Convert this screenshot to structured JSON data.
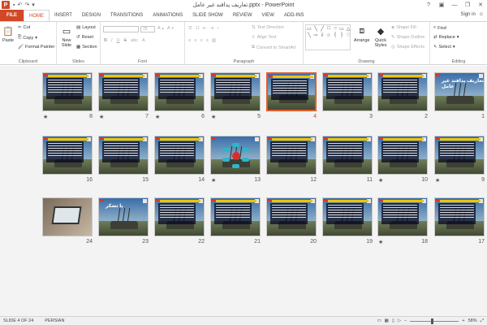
{
  "app": {
    "title": "تعاريف پدافند غير عامل.pptx - PowerPoint",
    "icon_letter": "P",
    "signin": "Sign in"
  },
  "tabs": [
    {
      "label": "FILE"
    },
    {
      "label": "HOME"
    },
    {
      "label": "INSERT"
    },
    {
      "label": "DESIGN"
    },
    {
      "label": "TRANSITIONS"
    },
    {
      "label": "ANIMATIONS"
    },
    {
      "label": "SLIDE SHOW"
    },
    {
      "label": "REVIEW"
    },
    {
      "label": "VIEW"
    },
    {
      "label": "ADD-INS"
    }
  ],
  "ribbon": {
    "clipboard": {
      "label": "Clipboard",
      "paste": "Paste",
      "cut": "Cut",
      "copy": "Copy",
      "format_painter": "Format Painter"
    },
    "slides": {
      "label": "Slides",
      "new_slide": "New Slide",
      "layout": "Layout",
      "reset": "Reset",
      "section": "Section"
    },
    "font": {
      "label": "Font",
      "size": "72"
    },
    "paragraph": {
      "label": "Paragraph",
      "text_direction": "Text Direction",
      "align_text": "Align Text",
      "convert_smartart": "Convert to SmartArt"
    },
    "drawing": {
      "label": "Drawing",
      "arrange": "Arrange",
      "quick_styles": "Quick Styles",
      "shape_fill": "Shape Fill",
      "shape_outline": "Shape Outline",
      "shape_effects": "Shape Effects"
    },
    "editing": {
      "label": "Editing",
      "find": "Find",
      "replace": "Replace",
      "select": "Select"
    }
  },
  "slides": [
    {
      "number": "1",
      "star": false,
      "kind": "title",
      "title_text": "تعاريف پدافند غير عامل"
    },
    {
      "number": "2",
      "star": false,
      "kind": "text"
    },
    {
      "number": "3",
      "star": false,
      "kind": "text"
    },
    {
      "number": "4",
      "star": false,
      "kind": "text",
      "selected": true
    },
    {
      "number": "5",
      "star": true,
      "kind": "text"
    },
    {
      "number": "6",
      "star": true,
      "kind": "text"
    },
    {
      "number": "7",
      "star": true,
      "kind": "text"
    },
    {
      "number": "8",
      "star": true,
      "kind": "text"
    },
    {
      "number": "9",
      "star": true,
      "kind": "text"
    },
    {
      "number": "10",
      "star": true,
      "kind": "text"
    },
    {
      "number": "11",
      "star": false,
      "kind": "text"
    },
    {
      "number": "12",
      "star": false,
      "kind": "text"
    },
    {
      "number": "13",
      "star": true,
      "kind": "diagram"
    },
    {
      "number": "14",
      "star": false,
      "kind": "text"
    },
    {
      "number": "15",
      "star": false,
      "kind": "text"
    },
    {
      "number": "16",
      "star": false,
      "kind": "text"
    },
    {
      "number": "17",
      "star": false,
      "kind": "text"
    },
    {
      "number": "18",
      "star": true,
      "kind": "text"
    },
    {
      "number": "19",
      "star": false,
      "kind": "text"
    },
    {
      "number": "20",
      "star": false,
      "kind": "text"
    },
    {
      "number": "21",
      "star": false,
      "kind": "text"
    },
    {
      "number": "22",
      "star": false,
      "kind": "text"
    },
    {
      "number": "23",
      "star": false,
      "kind": "thanks",
      "title_text": "با تشكر"
    },
    {
      "number": "24",
      "star": false,
      "kind": "laptop"
    }
  ],
  "status": {
    "slide_info": "SLIDE 4 OF 24",
    "language": "PERSIAN",
    "zoom": "58%"
  },
  "colors": {
    "accent": "#d24726",
    "selected_border": "#e55a2b"
  }
}
